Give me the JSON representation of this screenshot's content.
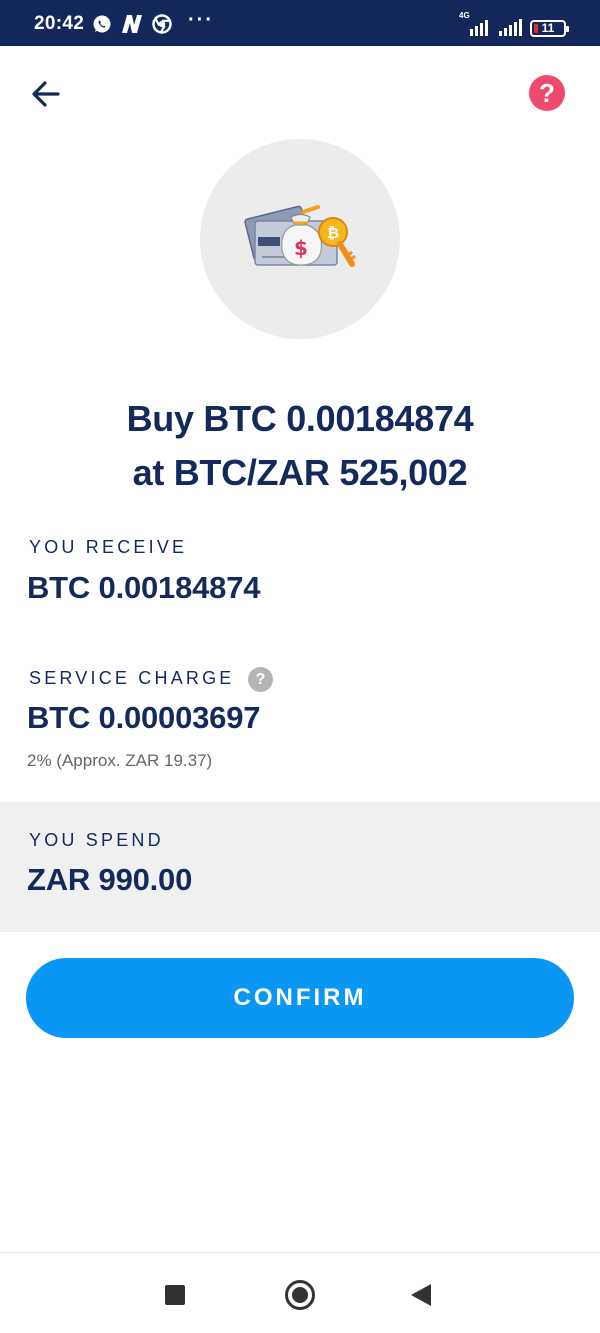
{
  "status_bar": {
    "time": "20:42",
    "network_label": "4G",
    "battery_level": "11",
    "more_indicator": "···",
    "icons": [
      "whatsapp-icon",
      "news-icon",
      "chrome-icon",
      "signal-icon",
      "signal-icon",
      "battery-icon"
    ]
  },
  "header": {
    "back_icon": "arrow-left-icon",
    "help_symbol": "?",
    "help_color": "#f04a6a"
  },
  "hero": {
    "illustration": "money-bag-and-bitcoin-key-illustration",
    "title_line1": "Buy BTC 0.00184874",
    "title_line2": "at BTC/ZAR 525,002"
  },
  "details": {
    "receive_label": "YOU RECEIVE",
    "receive_value": "BTC 0.00184874",
    "service_label": "SERVICE CHARGE",
    "service_info_symbol": "?",
    "service_value": "BTC 0.00003697",
    "service_note": "2% (Approx. ZAR 19.37)",
    "spend_label": "YOU SPEND",
    "spend_value": "ZAR 990.00"
  },
  "actions": {
    "confirm_label": "CONFIRM",
    "confirm_color": "#0a96f5"
  },
  "navigation": {
    "buttons": [
      "recent-apps-icon",
      "home-icon",
      "back-triangle-icon"
    ]
  },
  "colors": {
    "primary_text": "#142a5c",
    "status_bar_bg": "#13275a",
    "panel_bg": "#f0f0f0"
  }
}
